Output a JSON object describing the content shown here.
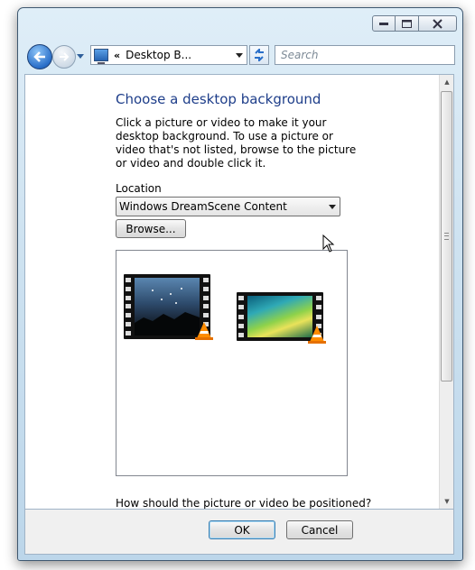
{
  "window": {
    "controls": {
      "minimize": "minimize-button",
      "maximize": "maximize-button",
      "close": "close-button"
    }
  },
  "nav": {
    "breadcrumb_chevron": "«",
    "address_text": "Desktop B...",
    "search_placeholder": "Search"
  },
  "main": {
    "title": "Choose a desktop background",
    "description": "Click a picture or video to make it your desktop background. To use a picture or video that's not listed, browse to the picture or video and double click it.",
    "location_label": "Location",
    "location_value": "Windows DreamScene Content",
    "browse_label": "Browse...",
    "position_question": "How should the picture or video be positioned?",
    "items": [
      {
        "icon": "video-thumbnail-night-sky"
      },
      {
        "icon": "video-thumbnail-aurora"
      }
    ]
  },
  "footer": {
    "ok_label": "OK",
    "cancel_label": "Cancel"
  },
  "colors": {
    "title": "#1e3e8a",
    "frame": "#cfe3f1",
    "accent": "#2a6fc9"
  }
}
